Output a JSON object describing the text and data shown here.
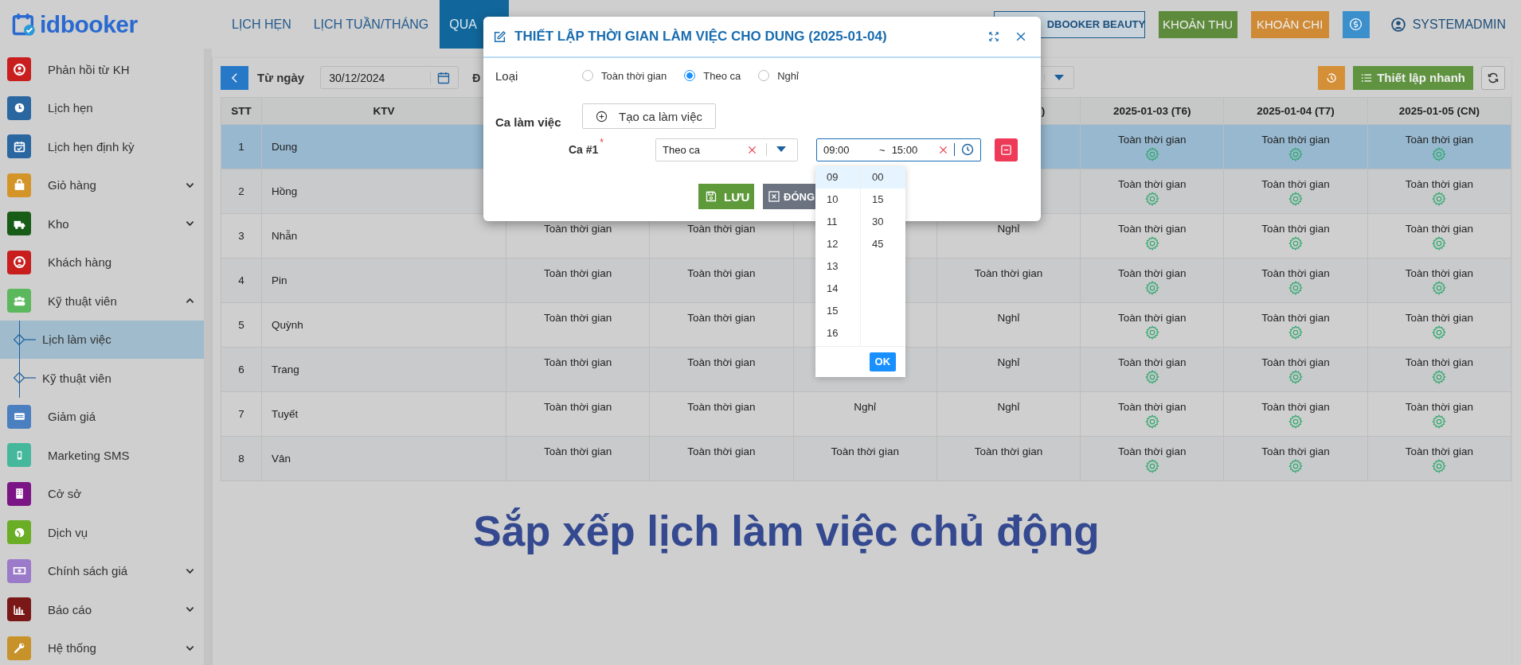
{
  "logo": {
    "text": "idbooker"
  },
  "nav_tabs": [
    {
      "label": "LỊCH HẸN",
      "selected": false
    },
    {
      "label": "LỊCH TUẦN/THÁNG",
      "selected": false
    },
    {
      "label": "QUA",
      "selected": true
    }
  ],
  "header_buttons": [
    {
      "label": "DBOOKER BEAUTY",
      "kind": "outline"
    },
    {
      "label": "KHOẢN THU",
      "kind": "income"
    },
    {
      "label": "KHOẢN CHI",
      "kind": "expense"
    }
  ],
  "user": {
    "name": "SYSTEMADMIN"
  },
  "sidebar": {
    "items": [
      {
        "label": "Phản hồi từ KH",
        "color": "#c81e1e",
        "selected": false
      },
      {
        "label": "Lịch hẹn",
        "color": "#2a66a0",
        "selected": false
      },
      {
        "label": "Lịch hẹn định kỳ",
        "color": "#2a66a0",
        "selected": false
      },
      {
        "label": "Giỏ hàng",
        "color": "#d39528",
        "selected": false,
        "expanded": false
      },
      {
        "label": "Kho",
        "color": "#175c17",
        "selected": false,
        "expanded": false
      },
      {
        "label": "Khách hàng",
        "color": "#c81e1e",
        "selected": false
      },
      {
        "label": "Kỹ thuật viên",
        "color": "#5cb85c",
        "selected": false,
        "expanded": true,
        "children": [
          {
            "label": "Lịch làm việc",
            "selected": true
          },
          {
            "label": "Kỹ thuật viên",
            "selected": false
          }
        ]
      },
      {
        "label": "Giảm giá",
        "color": "#4a7fc0",
        "selected": false
      },
      {
        "label": "Marketing SMS",
        "color": "#45b89b",
        "selected": false
      },
      {
        "label": "Cở sở",
        "color": "#7b1485",
        "selected": false
      },
      {
        "label": "Dịch vụ",
        "color": "#6aae25",
        "selected": false
      },
      {
        "label": "Chính sách giá",
        "color": "#9b7ac9",
        "selected": false,
        "expanded": false
      },
      {
        "label": "Báo cáo",
        "color": "#7a1818",
        "selected": false,
        "expanded": false
      },
      {
        "label": "Hệ thống",
        "color": "#c8922a",
        "selected": false,
        "expanded": false
      }
    ]
  },
  "toolbar": {
    "from_label": "Từ ngày",
    "from_date": "30/12/2024",
    "to_label": "Đ",
    "quick_setup": "Thiết lập nhanh"
  },
  "table": {
    "columns": [
      "STT",
      "KTV",
      "",
      "",
      "",
      ")",
      "2025-01-03 (T6)",
      "2025-01-04 (T7)",
      "2025-01-05 (CN)"
    ],
    "rows": [
      {
        "selected": true,
        "cells": [
          "1",
          "Dung",
          "",
          "",
          "",
          "",
          {
            "text": "Toàn thời gian",
            "gear": true
          },
          {
            "text": "Toàn thời gian",
            "gear": true
          },
          {
            "text": "Toàn thời gian",
            "gear": true
          }
        ]
      },
      {
        "selected": false,
        "cells": [
          "2",
          "Hồng",
          "",
          "",
          "",
          "",
          {
            "text": "Toàn thời gian",
            "gear": true
          },
          {
            "text": "Toàn thời gian",
            "gear": true
          },
          {
            "text": "Toàn thời gian",
            "gear": true
          }
        ]
      },
      {
        "selected": false,
        "cells": [
          "3",
          "Nhẫn",
          {
            "text": "Toàn thời gian",
            "gear": false
          },
          {
            "text": "Toàn thời gian",
            "gear": false
          },
          "",
          {
            "text": "Nghỉ",
            "gear": false
          },
          {
            "text": "Toàn thời gian",
            "gear": true
          },
          {
            "text": "Toàn thời gian",
            "gear": true
          },
          {
            "text": "Toàn thời gian",
            "gear": true
          }
        ]
      },
      {
        "selected": false,
        "cells": [
          "4",
          "Pin",
          {
            "text": "Toàn thời gian",
            "gear": false
          },
          {
            "text": "Toàn thời gian",
            "gear": false
          },
          "",
          {
            "text": "Toàn thời gian",
            "gear": false
          },
          {
            "text": "Toàn thời gian",
            "gear": true
          },
          {
            "text": "Toàn thời gian",
            "gear": true
          },
          {
            "text": "Toàn thời gian",
            "gear": true
          }
        ]
      },
      {
        "selected": false,
        "cells": [
          "5",
          "Quỳnh",
          {
            "text": "Toàn thời gian",
            "gear": false
          },
          {
            "text": "Toàn thời gian",
            "gear": false
          },
          "",
          {
            "text": "Nghỉ",
            "gear": false
          },
          {
            "text": "Toàn thời gian",
            "gear": true
          },
          {
            "text": "Toàn thời gian",
            "gear": true
          },
          {
            "text": "Toàn thời gian",
            "gear": true
          }
        ]
      },
      {
        "selected": false,
        "cells": [
          "6",
          "Trang",
          {
            "text": "Toàn thời gian",
            "gear": false
          },
          {
            "text": "Toàn thời gian",
            "gear": false
          },
          "",
          {
            "text": "Nghỉ",
            "gear": false
          },
          {
            "text": "Toàn thời gian",
            "gear": true
          },
          {
            "text": "Toàn thời gian",
            "gear": true
          },
          {
            "text": "Toàn thời gian",
            "gear": true
          }
        ]
      },
      {
        "selected": false,
        "cells": [
          "7",
          "Tuyết",
          {
            "text": "Toàn thời gian",
            "gear": false
          },
          {
            "text": "Toàn thời gian",
            "gear": false
          },
          {
            "text": "Nghỉ",
            "gear": false
          },
          {
            "text": "Nghỉ",
            "gear": false
          },
          {
            "text": "Toàn thời gian",
            "gear": true
          },
          {
            "text": "Toàn thời gian",
            "gear": true
          },
          {
            "text": "Toàn thời gian",
            "gear": true
          }
        ]
      },
      {
        "selected": false,
        "cells": [
          "8",
          "Vân",
          {
            "text": "Toàn thời gian",
            "gear": false
          },
          {
            "text": "Toàn thời gian",
            "gear": false
          },
          {
            "text": "Toàn thời gian",
            "gear": false
          },
          {
            "text": "Toàn thời gian",
            "gear": false
          },
          {
            "text": "Toàn thời gian",
            "gear": true
          },
          {
            "text": "Toàn thời gian",
            "gear": true
          },
          {
            "text": "Toàn thời gian",
            "gear": true
          }
        ]
      }
    ]
  },
  "caption": "Sắp xếp lịch làm việc chủ động",
  "modal": {
    "title": "THIẾT LẬP THỜI GIAN LÀM VIỆC CHO DUNG (2025-01-04)",
    "type_label": "Loại",
    "type_options": [
      {
        "label": "Toàn thời gian",
        "selected": false
      },
      {
        "label": "Theo ca",
        "selected": true
      },
      {
        "label": "Nghỉ",
        "selected": false
      }
    ],
    "shift_label": "Ca làm việc",
    "create_button": "Tạo ca làm việc",
    "shifts": [
      {
        "label": "Ca #1",
        "required_mark": "*",
        "mode": "Theo ca",
        "start": "09:00",
        "separator": "~",
        "end": "15:00"
      }
    ],
    "save_button": "LƯU",
    "close_button": "ĐÓNG"
  },
  "time_picker": {
    "hours": [
      {
        "value": "09",
        "selected": true
      },
      {
        "value": "10",
        "selected": false
      },
      {
        "value": "11",
        "selected": false
      },
      {
        "value": "12",
        "selected": false
      },
      {
        "value": "13",
        "selected": false
      },
      {
        "value": "14",
        "selected": false
      },
      {
        "value": "15",
        "selected": false
      },
      {
        "value": "16",
        "selected": false
      }
    ],
    "minutes": [
      {
        "value": "00",
        "selected": true
      },
      {
        "value": "15",
        "selected": false
      },
      {
        "value": "30",
        "selected": false
      },
      {
        "value": "45",
        "selected": false
      }
    ],
    "ok_button": "OK"
  }
}
